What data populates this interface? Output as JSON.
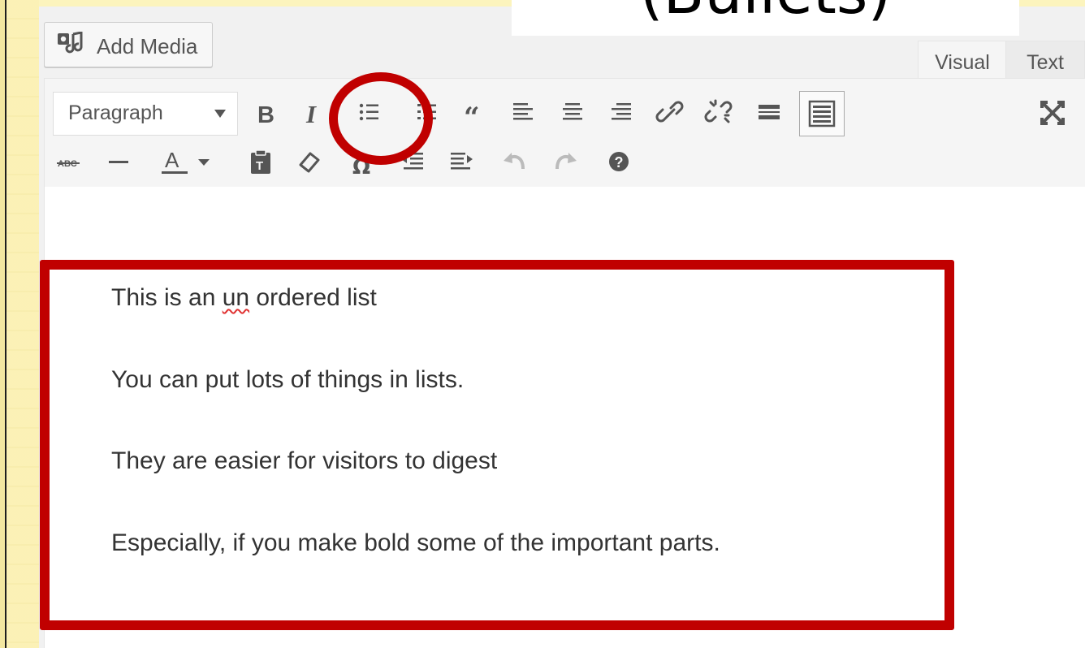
{
  "caption": {
    "text": "(Bullets)"
  },
  "editor": {
    "add_media_label": "Add Media",
    "tabs": [
      {
        "label": "Visual"
      },
      {
        "label": "Text"
      }
    ],
    "format_select_value": "Paragraph",
    "toolbar_row1": [
      "bold-icon",
      "italic-icon",
      "bulleted-list-icon",
      "numbered-list-icon",
      "blockquote-icon",
      "align-left-icon",
      "align-center-icon",
      "align-right-icon",
      "insert-link-icon",
      "remove-link-icon",
      "read-more-icon",
      "toolbar-toggle-icon",
      "fullscreen-icon"
    ],
    "toolbar_row2": [
      "strikethrough-icon",
      "horizontal-line-icon",
      "text-color-icon",
      "paste-as-text-icon",
      "clear-formatting-icon",
      "special-character-icon",
      "outdent-icon",
      "indent-icon",
      "undo-icon",
      "redo-icon",
      "help-icon"
    ],
    "content": {
      "paragraphs": [
        {
          "before": "This is an ",
          "misspelled": "un",
          "after": " ordered list"
        },
        {
          "text": "You can put lots of things in lists."
        },
        {
          "text": "They are easier for visitors to digest"
        },
        {
          "text": "Especially, if you make bold some of the important parts."
        }
      ]
    }
  },
  "colors": {
    "highlight": "#c00000",
    "background": "#fcf4bd",
    "toolbar": "#f5f5f5",
    "icon": "#555555"
  }
}
